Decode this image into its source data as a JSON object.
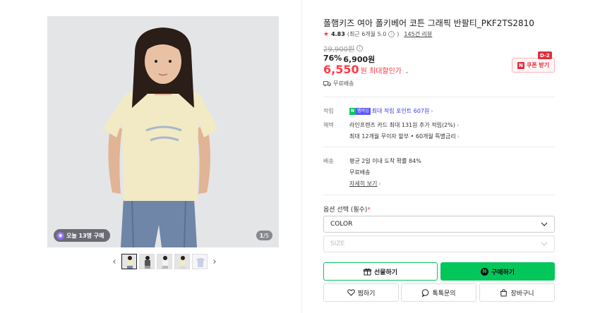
{
  "gallery": {
    "purchase_badge": "오늘 13명 구매",
    "counter_current": "1",
    "counter_total": "/5",
    "prev_icon": "chevron-left-icon",
    "next_icon": "chevron-right-icon",
    "thumbnail_count": 5
  },
  "product": {
    "title": "폴햄키즈 여아 폴키베어 코튼 그래픽 반팔티_PKF2TS2810",
    "rating": "4.83",
    "rating_detail": "(최근 6개월 5.0",
    "rating_detail_end": ")",
    "review_link": "145건 리뷰",
    "original_price": "29,900원",
    "discount_rate": "76%",
    "sale_price": "6,900원",
    "max_discount_price": "6,550",
    "max_discount_unit": "원 최대할인가",
    "coupon_label": "쿠폰 받기",
    "coupon_dday": "D-2",
    "free_shipping": "무료배송"
  },
  "benefits": {
    "points_label": "적립",
    "points_badge_a": "N",
    "points_badge_b": "멤버십",
    "points_text": "최대 적립 포인트 607원",
    "perks_label": "혜택",
    "perk_1": "라인프렌즈 카드 최대 131원 추가 적립(2%)",
    "perk_2": "최대 12개월 무이자 할부 • 60개월 특별금리"
  },
  "delivery": {
    "label": "배송",
    "line_1": "평균 2일 이내 도착 확률 84%",
    "line_2": "무료배송",
    "detail_link": "자세히 보기"
  },
  "options": {
    "label": "옵션 선택 (필수)",
    "required_mark": "*",
    "color_value": "COLOR",
    "size_value": "SIZE"
  },
  "actions": {
    "gift": "선물하기",
    "buy": "구매하기",
    "wish": "찜하기",
    "talk": "톡톡문의",
    "cart": "장바구니"
  },
  "colors": {
    "accent_red": "#ff3a46",
    "naver_green": "#03c75a"
  }
}
